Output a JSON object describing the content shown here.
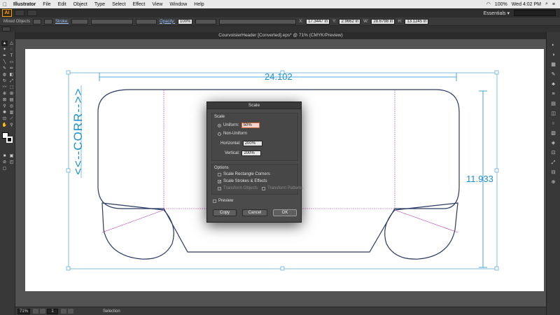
{
  "menubar": {
    "apple": "",
    "items": [
      "Illustrator",
      "File",
      "Edit",
      "Object",
      "Type",
      "Select",
      "Effect",
      "View",
      "Window",
      "Help"
    ],
    "status": {
      "time": "Wed 4:02 PM",
      "battery": "100%"
    }
  },
  "appbar": {
    "logo": "Ai",
    "workspace": "Essentials ▾"
  },
  "controlbar": {
    "selection_label": "Mixed Objects",
    "stroke_label": "Stroke:",
    "opacity_label": "Opacity:",
    "opacity_value": "100%",
    "x_label": "X:",
    "x_value": "17.3447 in",
    "y_label": "Y:",
    "y_value": "2.9662 in",
    "w_label": "W:",
    "w_value": "28.6798 in",
    "h_label": "H:",
    "h_value": "13.1245 in"
  },
  "document": {
    "title": "CourvoisierHeader [Converted].eps* @ 71% (CMYK/Preview)"
  },
  "artwork": {
    "width_dimension": "24.102",
    "height_dimension": "11.933",
    "side_text": "<<--CORR-->>"
  },
  "dialog": {
    "title": "Scale",
    "scale_group": "Scale",
    "uniform_label": "Uniform:",
    "uniform_value": "50%",
    "nonuniform_label": "Non-Uniform",
    "horizontal_label": "Horizontal:",
    "horizontal_value": "200%",
    "vertical_label": "Vertical:",
    "vertical_value": "200%",
    "options_group": "Options",
    "opt_corners": "Scale Rectangle Corners",
    "opt_strokes": "Scale Strokes & Effects",
    "opt_objects": "Transform Objects",
    "opt_patterns": "Transform Patterns",
    "preview_label": "Preview",
    "copy_label": "Copy",
    "cancel_label": "Cancel",
    "ok_label": "OK"
  },
  "statusbar": {
    "zoom": "71%",
    "page": "1",
    "selection_tool": "Selection"
  },
  "colors": {
    "guide_blue": "#1e8fd0",
    "path_dark": "#2c3a66",
    "path_magenta": "#b03ab0"
  }
}
